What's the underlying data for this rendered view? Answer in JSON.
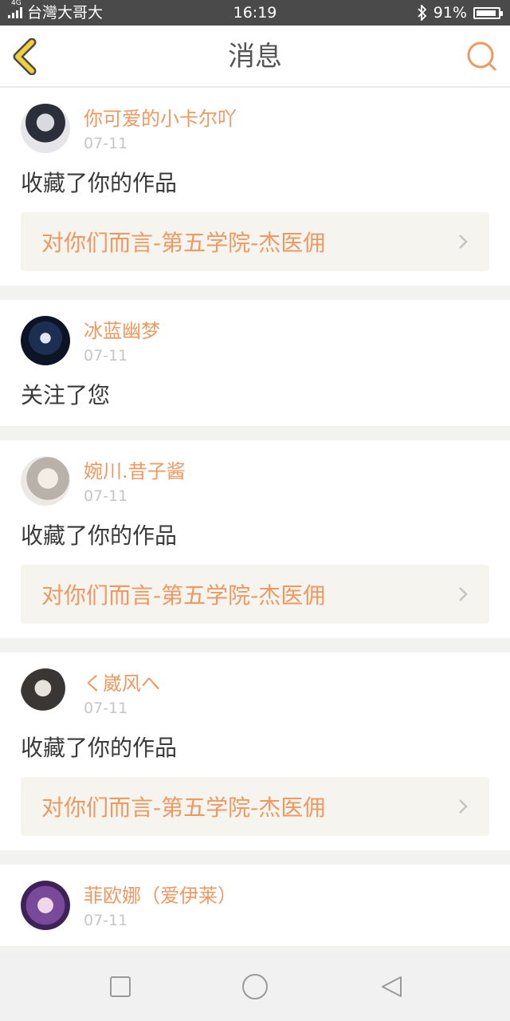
{
  "status_bar": {
    "network_type": "4G",
    "carrier": "台灣大哥大",
    "time": "16:19",
    "battery_percent": "91%",
    "battery_level": 0.91,
    "icons": [
      "signal-icon",
      "bluetooth-icon",
      "battery-icon"
    ]
  },
  "header": {
    "title": "消息",
    "back_icon": "chevron-left-icon",
    "search_icon": "search-icon",
    "accent_color": "#ee9862",
    "back_color": "#f2cf3c"
  },
  "messages": [
    {
      "user": "你可爱的小卡尔吖",
      "date": "07-11",
      "action": "收藏了你的作品",
      "work": "对你们而言-第五学院-杰医佣"
    },
    {
      "user": "冰蓝幽梦",
      "date": "07-11",
      "action": "关注了您",
      "work": null
    },
    {
      "user": "婉川.昔子酱",
      "date": "07-11",
      "action": "收藏了你的作品",
      "work": "对你们而言-第五学院-杰医佣"
    },
    {
      "user": "く崴风へ",
      "date": "07-11",
      "action": "收藏了你的作品",
      "work": "对你们而言-第五学院-杰医佣"
    },
    {
      "user": "菲欧娜（爱伊莱）",
      "date": "07-11",
      "action": "",
      "work": null
    }
  ],
  "system_nav": {
    "icons": [
      "recent-apps-icon",
      "home-icon",
      "back-triangle-icon"
    ]
  }
}
